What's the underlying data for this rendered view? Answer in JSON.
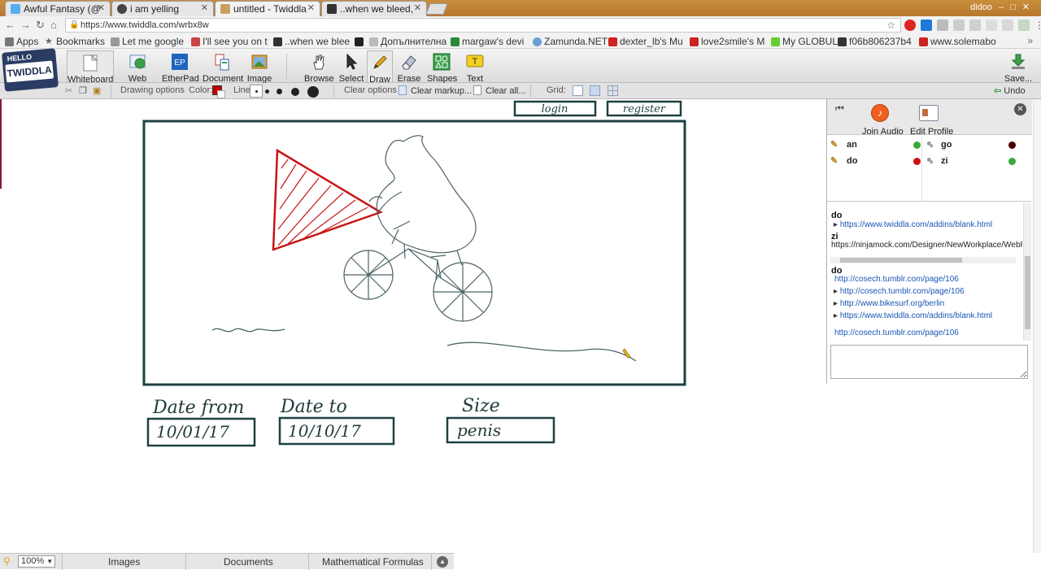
{
  "browser": {
    "tabs": [
      {
        "title": "Awful Fantasy (@",
        "active": false
      },
      {
        "title": "i am yelling",
        "active": false
      },
      {
        "title": "untitled - Twiddla",
        "active": true
      },
      {
        "title": "..when we bleed,",
        "active": false
      }
    ],
    "user_label": "didoo",
    "url": "https://www.twiddla.com/wrbx8w",
    "bookmarks": [
      "Apps",
      "Bookmarks",
      "Let me google",
      "I'll see you on t",
      "..when we blee",
      "",
      "Допълнителна",
      "margaw's devi",
      "Zamunda.NET",
      "dexter_lb's Mu",
      "love2smile's M",
      "My GLOBUL",
      "f06b806237b4",
      "www.solemabo"
    ]
  },
  "logo": {
    "line1": "HELLO",
    "line2": "TWIDDLA"
  },
  "toolbar": {
    "tools": [
      {
        "label": "Whiteboard"
      },
      {
        "label": "Web Page"
      },
      {
        "label": "EtherPad"
      },
      {
        "label": "Document"
      },
      {
        "label": "Image"
      },
      {
        "label": "Browse"
      },
      {
        "label": "Select"
      },
      {
        "label": "Draw"
      },
      {
        "label": "Erase"
      },
      {
        "label": "Shapes"
      },
      {
        "label": "Text"
      },
      {
        "label": "Save..."
      }
    ],
    "etherpad_icon": "EP",
    "text_icon": "T"
  },
  "options": {
    "drawing_options": "Drawing options",
    "color_label": "Color:",
    "line_label": "Line:",
    "clear_options": "Clear options",
    "clear_markup": "Clear markup...",
    "clear_all": "Clear all...",
    "grid_label": "Grid:",
    "undo": "Undo",
    "color": "#c40000"
  },
  "whiteboard": {
    "login": "login",
    "register": "register",
    "fields": [
      {
        "label": "Date from",
        "value": "10/01/17"
      },
      {
        "label": "Date to",
        "value": "10/10/17"
      },
      {
        "label": "Size",
        "value": "penis"
      }
    ]
  },
  "panel": {
    "join_audio": "Join Audio",
    "edit_profile": "Edit Profile",
    "users": [
      {
        "name": "an",
        "tool": "pencil-icon",
        "status": "#3aa83a"
      },
      {
        "name": "do",
        "tool": "pencil-icon",
        "status": "#cc1111"
      },
      {
        "name": "go",
        "tool": "cursor-icon",
        "status": "#4a0000"
      },
      {
        "name": "zi",
        "tool": "cursor-icon",
        "status": "#3aa83a"
      }
    ],
    "chat": {
      "entries": [
        {
          "type": "name",
          "text": "do"
        },
        {
          "type": "link",
          "text": "https://www.twiddla.com/addins/blank.html",
          "arrow": true
        },
        {
          "type": "name",
          "text": "zi"
        },
        {
          "type": "text",
          "text": "https://ninjamock.com/Designer/NewWorkplace/WebPro"
        },
        {
          "type": "name",
          "text": "do"
        },
        {
          "type": "link",
          "text": "http://cosech.tumblr.com/page/106",
          "arrow": false
        },
        {
          "type": "link",
          "text": "http://cosech.tumblr.com/page/106",
          "arrow": true
        },
        {
          "type": "link",
          "text": "http://www.bikesurf.org/berlin",
          "arrow": true
        },
        {
          "type": "link",
          "text": "https://www.twiddla.com/addins/blank.html",
          "arrow": true
        },
        {
          "type": "link",
          "text": "http://cosech.tumblr.com/page/106",
          "arrow": false
        }
      ]
    }
  },
  "bottombar": {
    "zoom": "100%",
    "tabs": [
      "Images",
      "Documents",
      "Mathematical Formulas"
    ]
  }
}
